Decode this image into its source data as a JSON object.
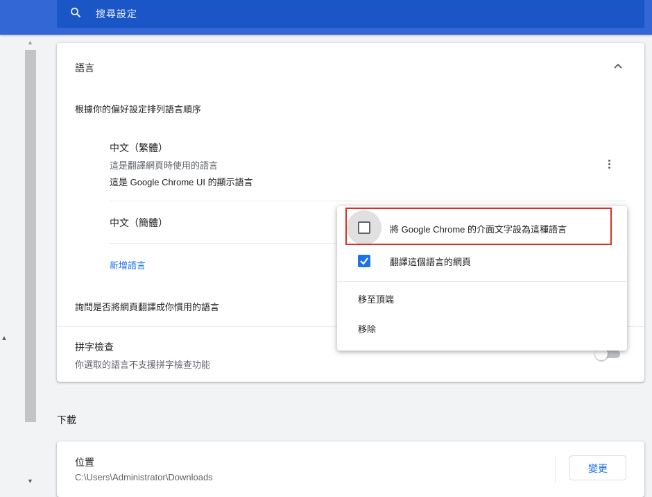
{
  "search": {
    "placeholder": "搜尋設定",
    "icon": "search-icon"
  },
  "languages_card": {
    "title": "語言",
    "order_label": "根據你的偏好設定排列語言順序",
    "languages": [
      {
        "name": "中文（繁體）",
        "line1": "這是翻譯網頁時使用的語言",
        "line2": "這是 Google Chrome UI 的顯示語言"
      },
      {
        "name": "中文（簡體）"
      }
    ],
    "add_language": "新增語言",
    "offer_translate": "詢問是否將網頁翻譯成你慣用的語言",
    "spellcheck_title": "拼字檢查",
    "spellcheck_desc": "你選取的語言不支援拼字檢查功能"
  },
  "context_menu": {
    "display_in_language": {
      "label": "將 Google Chrome 的介面文字設為這種語言",
      "checked": false
    },
    "translate_pages": {
      "label": "翻譯這個語言的網頁",
      "checked": true
    },
    "move_to_top": "移至頂端",
    "remove": "移除"
  },
  "downloads": {
    "section_title": "下載",
    "location_label": "位置",
    "location_path": "C:\\Users\\Administrator\\Downloads",
    "change_button": "變更"
  },
  "colors": {
    "header": "#3367d6",
    "accent": "#1a73e8",
    "highlight_border": "#d93025"
  }
}
